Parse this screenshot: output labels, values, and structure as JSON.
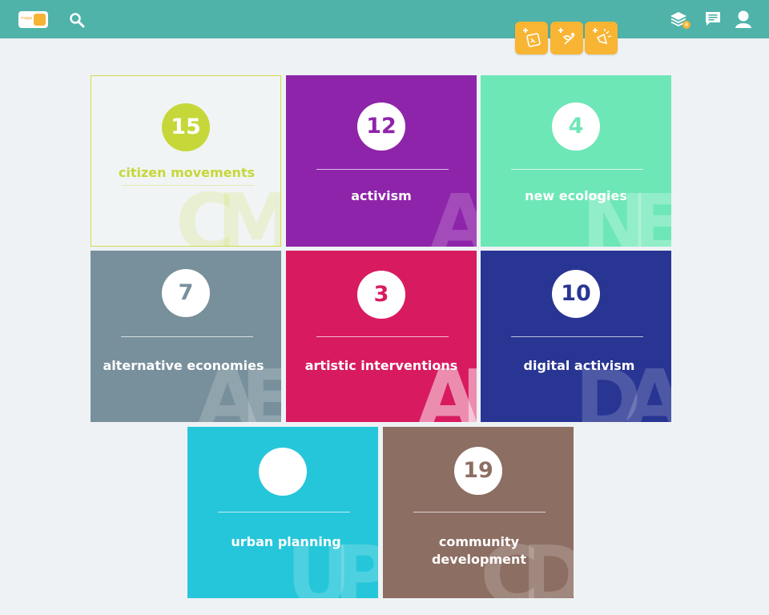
{
  "header": {
    "logo_text": "mapp",
    "icons": [
      "search-icon",
      "add-pin-icon",
      "add-place-icon",
      "add-event-icon",
      "layers-icon",
      "chat-icon",
      "user-icon"
    ],
    "layers_badge": "4"
  },
  "categories": [
    {
      "label": "citizen movements",
      "count": "15",
      "initials": "CM",
      "color": "#f1f4f5",
      "accent": "#c6d839"
    },
    {
      "label": "activism",
      "count": "12",
      "initials": "A",
      "color": "#8e24aa"
    },
    {
      "label": "new ecologies",
      "count": "4",
      "initials": "NE",
      "color": "#6ee7b7"
    },
    {
      "label": "alternative economies",
      "count": "7",
      "initials": "AE",
      "color": "#78909c"
    },
    {
      "label": "artistic interventions",
      "count": "3",
      "initials": "AI",
      "color": "#d81b60"
    },
    {
      "label": "digital activism",
      "count": "10",
      "initials": "DA",
      "color": "#283593"
    },
    {
      "label": "urban planning",
      "count": "",
      "initials": "UP",
      "color": "#26c6da"
    },
    {
      "label": "community development",
      "count": "19",
      "initials": "CD",
      "color": "#8d6e63"
    }
  ]
}
